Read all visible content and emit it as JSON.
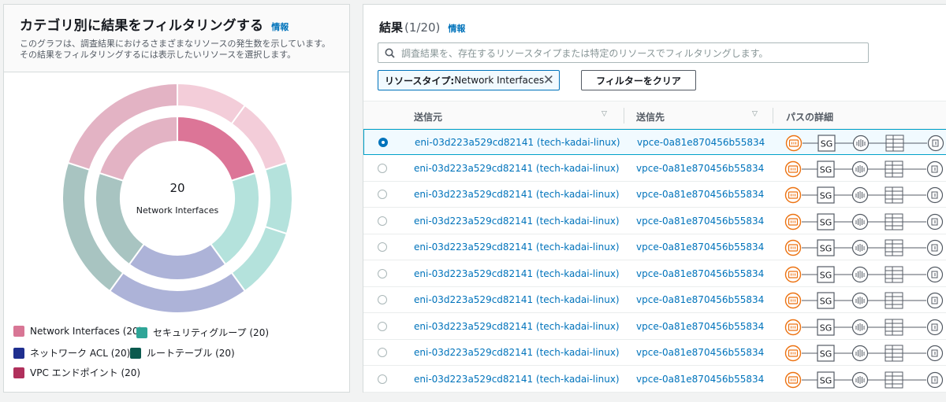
{
  "left": {
    "title": "カテゴリ別に結果をフィルタリングする",
    "info": "情報",
    "description": "このグラフは、調査結果におけるさまざまなリソースの発生数を示しています。その結果をフィルタリングするには表示したいリソースを選択します。",
    "center_count": "20",
    "center_label": "Network Interfaces"
  },
  "legend": [
    {
      "label": "Network Interfaces (20)",
      "color": "#d87695"
    },
    {
      "label": "セキュリティグループ (20)",
      "color": "#2ea597"
    },
    {
      "label": "ネットワーク ACL (20)",
      "color": "#1f2f8f"
    },
    {
      "label": "ルートテーブル (20)",
      "color": "#0b5a4e"
    },
    {
      "label": "VPC エンドポイント (20)",
      "color": "#b0305c"
    }
  ],
  "right": {
    "title": "結果",
    "count": "(1/20)",
    "info": "情報",
    "search_placeholder": "調査結果を、存在するリソースタイプまたは特定のリソースでフィルタリングします。",
    "token_key": "リソースタイプ:",
    "token_value": " Network Interfaces",
    "clear_button": "フィルターをクリア"
  },
  "columns": [
    "送信元",
    "送信先",
    "パスの詳細"
  ],
  "rows": [
    {
      "source": "eni-03d223a529cd82141 (tech-kadai-linux)",
      "dest": "vpce-0a81e870456b55834",
      "selected": true
    },
    {
      "source": "eni-03d223a529cd82141 (tech-kadai-linux)",
      "dest": "vpce-0a81e870456b55834",
      "selected": false
    },
    {
      "source": "eni-03d223a529cd82141 (tech-kadai-linux)",
      "dest": "vpce-0a81e870456b55834",
      "selected": false
    },
    {
      "source": "eni-03d223a529cd82141 (tech-kadai-linux)",
      "dest": "vpce-0a81e870456b55834",
      "selected": false
    },
    {
      "source": "eni-03d223a529cd82141 (tech-kadai-linux)",
      "dest": "vpce-0a81e870456b55834",
      "selected": false
    },
    {
      "source": "eni-03d223a529cd82141 (tech-kadai-linux)",
      "dest": "vpce-0a81e870456b55834",
      "selected": false
    },
    {
      "source": "eni-03d223a529cd82141 (tech-kadai-linux)",
      "dest": "vpce-0a81e870456b55834",
      "selected": false
    },
    {
      "source": "eni-03d223a529cd82141 (tech-kadai-linux)",
      "dest": "vpce-0a81e870456b55834",
      "selected": false
    },
    {
      "source": "eni-03d223a529cd82141 (tech-kadai-linux)",
      "dest": "vpce-0a81e870456b55834",
      "selected": false
    },
    {
      "source": "eni-03d223a529cd82141 (tech-kadai-linux)",
      "dest": "vpce-0a81e870456b55834",
      "selected": false
    }
  ],
  "path_icons": [
    "network-interface-icon",
    "security-group-icon",
    "network-acl-icon",
    "route-table-icon",
    "vpc-endpoint-icon"
  ],
  "path_sg_label": "SG",
  "donut": {
    "inner": [
      {
        "category": "Network Interfaces",
        "value": 20,
        "color": "#dc7597"
      },
      {
        "category": "セキュリティグループ",
        "value": 20,
        "color": "#b4e2dc"
      },
      {
        "category": "ネットワーク ACL",
        "value": 20,
        "color": "#adb3d8"
      },
      {
        "category": "ルートテーブル",
        "value": 20,
        "color": "#a8c4c1"
      },
      {
        "category": "VPC エンドポイント",
        "value": 20,
        "color": "#e3b3c4"
      }
    ],
    "outer": [
      {
        "value": 10,
        "color": "#f3cdd9"
      },
      {
        "value": 10,
        "color": "#f3cdd9"
      },
      {
        "value": 10,
        "color": "#b4e2dc"
      },
      {
        "value": 10,
        "color": "#b4e2dc"
      },
      {
        "value": 20,
        "color": "#adb3d8"
      },
      {
        "value": 20,
        "color": "#a8c4c1"
      },
      {
        "value": 20,
        "color": "#e3b3c4"
      }
    ]
  }
}
